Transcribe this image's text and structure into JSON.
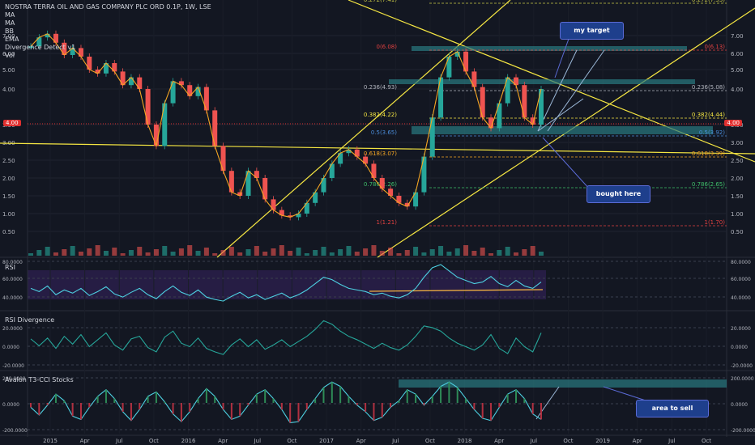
{
  "chart_data": [
    {
      "type": "line",
      "title": "NOSTRA TERRA OIL AND GAS COMPANY PLC ORD 0.1P, 1W, LSE",
      "indicators": [
        "MA",
        "MA",
        "BB",
        "EMA",
        "Divergence Detect v1",
        "Vol"
      ],
      "x_tick_labels": [
        "2015",
        "Apr",
        "Jul",
        "Oct",
        "2016",
        "Apr",
        "Jul",
        "Oct",
        "2017",
        "Apr",
        "Jul",
        "Oct",
        "2018",
        "Apr",
        "Jul",
        "Oct",
        "2019",
        "Apr",
        "Jul",
        "Oct"
      ],
      "y_tick_labels": [
        "7.00",
        "6.00",
        "5.00",
        "4.00",
        "3.50",
        "3.00",
        "2.50",
        "2.00",
        "1.50",
        "1.00",
        "0.50"
      ],
      "current_price": "4.00",
      "series": [
        {
          "values": [
            6.4,
            6.9,
            7.1,
            6.6,
            5.9,
            6.3,
            5.8,
            5.0,
            4.8,
            5.4,
            4.9,
            4.2,
            4.6,
            4.0,
            3.5,
            2.9,
            3.8,
            4.4,
            4.2,
            3.9,
            4.1,
            3.7,
            2.9,
            2.2,
            1.6,
            1.5,
            2.2,
            2.0,
            1.4,
            1.1,
            0.95,
            0.9,
            1.0,
            1.3,
            1.6,
            2.0,
            2.4,
            2.7,
            2.8,
            2.6,
            2.4,
            2.0,
            1.7,
            1.5,
            1.3,
            1.2,
            1.6,
            2.6,
            3.6,
            4.6,
            5.8,
            6.1,
            4.9,
            4.1,
            3.6,
            3.4,
            3.8,
            4.6,
            4.2,
            3.6,
            3.5,
            4.0
          ]
        }
      ],
      "annotations": [
        "my target",
        "bought here"
      ],
      "fib_levels": [
        {
          "label": "0.272(7.41)"
        },
        {
          "label": "0(6.08)"
        },
        {
          "label": "0.236(4.93)"
        },
        {
          "label": "0.382(4.22)"
        },
        {
          "label": "0.5(3.65)"
        },
        {
          "label": "0.618(3.07)"
        },
        {
          "label": "0.786(2.26)"
        },
        {
          "label": "1(1.21)"
        }
      ],
      "fib_levels_right": [
        {
          "label": "0.272(7.33)"
        },
        {
          "label": "0(6.13)"
        },
        {
          "label": "0.236(5.08)"
        },
        {
          "label": "0.382(4.44)"
        },
        {
          "label": "0.5(3.92)"
        },
        {
          "label": "0.618(3.39)"
        },
        {
          "label": "0.786(2.65)"
        },
        {
          "label": "1(1.70)"
        }
      ]
    },
    {
      "type": "line",
      "title": "RSI",
      "y_tick_labels": [
        "80.0000",
        "60.0000",
        "40.0000"
      ],
      "ylim": [
        30,
        85
      ],
      "values": [
        52,
        48,
        55,
        44,
        50,
        46,
        52,
        43,
        48,
        54,
        45,
        41,
        47,
        52,
        44,
        39,
        48,
        55,
        47,
        43,
        50,
        41,
        38,
        36,
        42,
        47,
        40,
        44,
        38,
        42,
        46,
        40,
        44,
        50,
        58,
        66,
        63,
        57,
        52,
        50,
        48,
        44,
        46,
        42,
        40,
        44,
        52,
        66,
        78,
        82,
        74,
        66,
        62,
        58,
        60,
        67,
        58,
        54,
        62,
        55,
        52,
        60
      ]
    },
    {
      "type": "line",
      "title": "RSI Divergence",
      "y_tick_labels": [
        "20.0000",
        "0.0000",
        "-20.0000"
      ],
      "ylim": [
        -28,
        30
      ],
      "values": [
        3,
        -5,
        4,
        -8,
        6,
        -3,
        8,
        -6,
        2,
        10,
        -4,
        -10,
        3,
        6,
        -7,
        -12,
        5,
        12,
        -2,
        -6,
        4,
        -8,
        -12,
        -15,
        -4,
        3,
        -6,
        2,
        -9,
        -4,
        2,
        -6,
        0,
        6,
        14,
        24,
        20,
        12,
        6,
        2,
        -3,
        -8,
        -2,
        -7,
        -10,
        -4,
        6,
        18,
        16,
        12,
        4,
        -2,
        -6,
        -10,
        -4,
        8,
        -8,
        -14,
        4,
        -6,
        -12,
        10
      ]
    },
    {
      "type": "area",
      "title": "Avalon T3-CCI Stocks",
      "y_tick_labels": [
        "200.0000",
        "0.0000",
        "-200.0000"
      ],
      "ylim": [
        -250,
        250
      ],
      "annotations": [
        "area to sell"
      ],
      "values": [
        -40,
        -110,
        -20,
        80,
        20,
        -120,
        -150,
        -40,
        60,
        120,
        40,
        -80,
        -160,
        -60,
        60,
        100,
        10,
        -100,
        -170,
        -80,
        40,
        130,
        60,
        -60,
        -150,
        -120,
        -20,
        80,
        120,
        40,
        -60,
        -180,
        -170,
        -60,
        40,
        140,
        190,
        150,
        60,
        -20,
        -80,
        -160,
        -130,
        -40,
        20,
        120,
        80,
        -20,
        60,
        150,
        190,
        140,
        40,
        -60,
        -140,
        -160,
        -40,
        80,
        120,
        40,
        -100,
        -150
      ]
    }
  ]
}
